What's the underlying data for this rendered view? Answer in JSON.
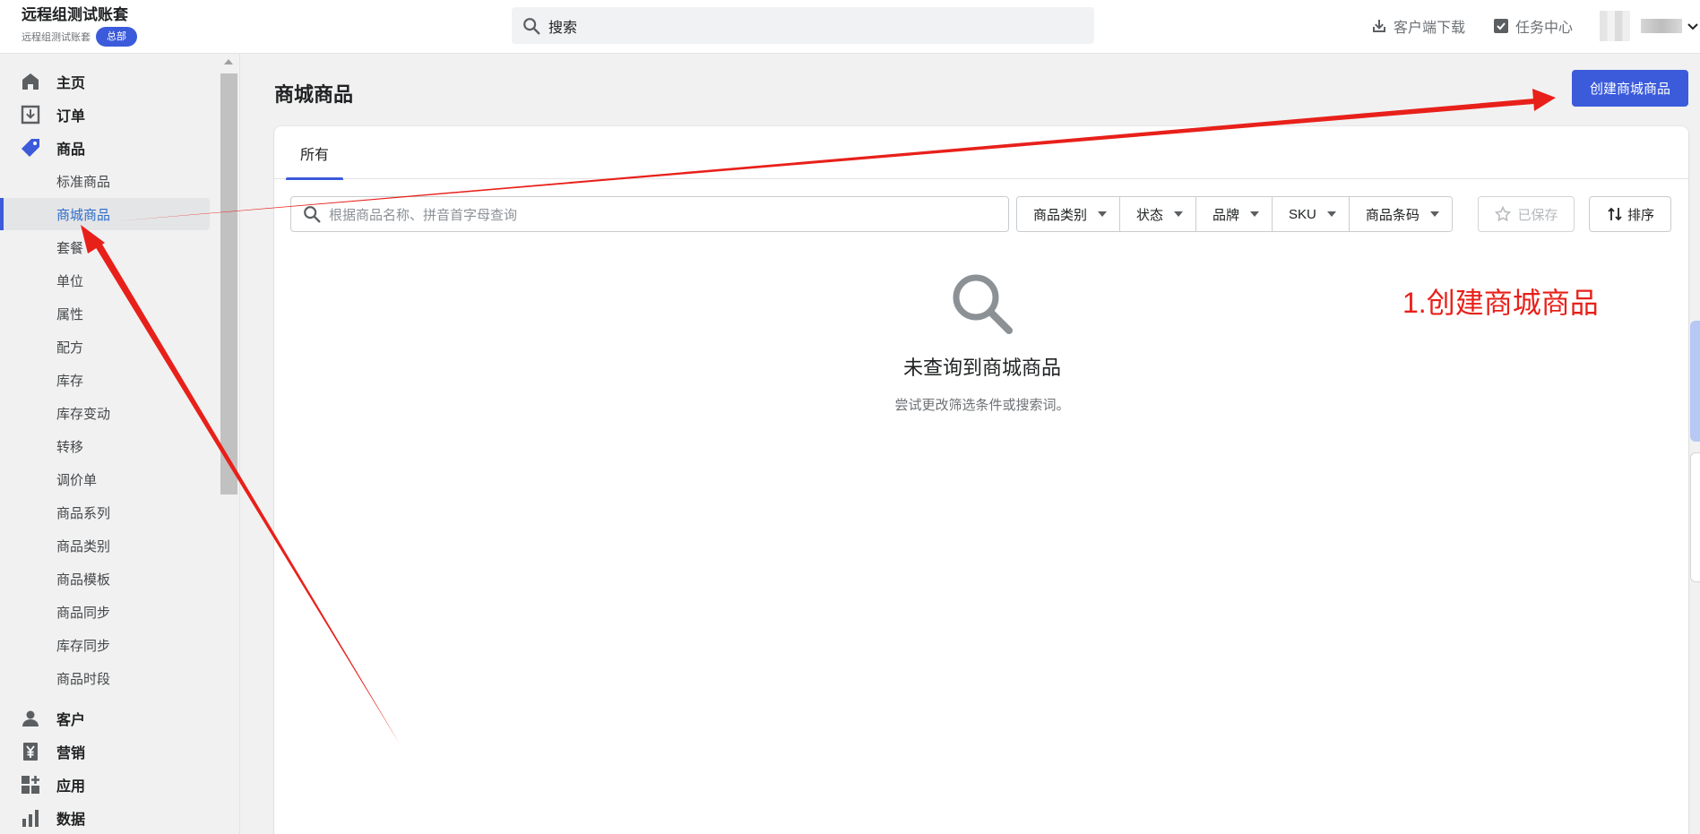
{
  "header": {
    "brand_title": "远程组测试账套",
    "brand_subtitle": "远程组测试账套",
    "badge": "总部",
    "search_placeholder": "搜索",
    "actions": [
      {
        "label": "客户端下载",
        "icon": "download-icon"
      },
      {
        "label": "任务中心",
        "icon": "task-icon"
      }
    ]
  },
  "sidebar": {
    "main_items": [
      {
        "label": "主页",
        "icon": "home-icon"
      },
      {
        "label": "订单",
        "icon": "order-icon"
      },
      {
        "label": "商品",
        "icon": "tag-icon"
      }
    ],
    "product_sub_items": [
      {
        "label": "标准商品"
      },
      {
        "label": "商城商品",
        "active": true
      },
      {
        "label": "套餐"
      },
      {
        "label": "单位"
      },
      {
        "label": "属性"
      },
      {
        "label": "配方"
      },
      {
        "label": "库存"
      },
      {
        "label": "库存变动"
      },
      {
        "label": "转移"
      },
      {
        "label": "调价单"
      },
      {
        "label": "商品系列"
      },
      {
        "label": "商品类别"
      },
      {
        "label": "商品模板"
      },
      {
        "label": "商品同步"
      },
      {
        "label": "库存同步"
      },
      {
        "label": "商品时段"
      }
    ],
    "bottom_items": [
      {
        "label": "客户",
        "icon": "customer-icon"
      },
      {
        "label": "营销",
        "icon": "marketing-icon"
      },
      {
        "label": "应用",
        "icon": "apps-icon"
      },
      {
        "label": "数据",
        "icon": "analytics-icon"
      }
    ]
  },
  "main": {
    "page_title": "商城商品",
    "create_button": "创建商城商品",
    "tabs": [
      {
        "label": "所有",
        "active": true
      }
    ],
    "filter_search_placeholder": "根据商品名称、拼音首字母查询",
    "filters": [
      "商品类别",
      "状态",
      "品牌",
      "SKU",
      "商品条码"
    ],
    "saved_button": "已保存",
    "sort_button": "排序",
    "empty_state": {
      "title": "未查询到商城商品",
      "subtitle": "尝试更改筛选条件或搜索词。"
    }
  },
  "annotation": {
    "text": "1.创建商城商品",
    "color": "#e8201a"
  },
  "colors": {
    "accent": "#3b5bdb",
    "active_link": "#2c6ecb"
  }
}
